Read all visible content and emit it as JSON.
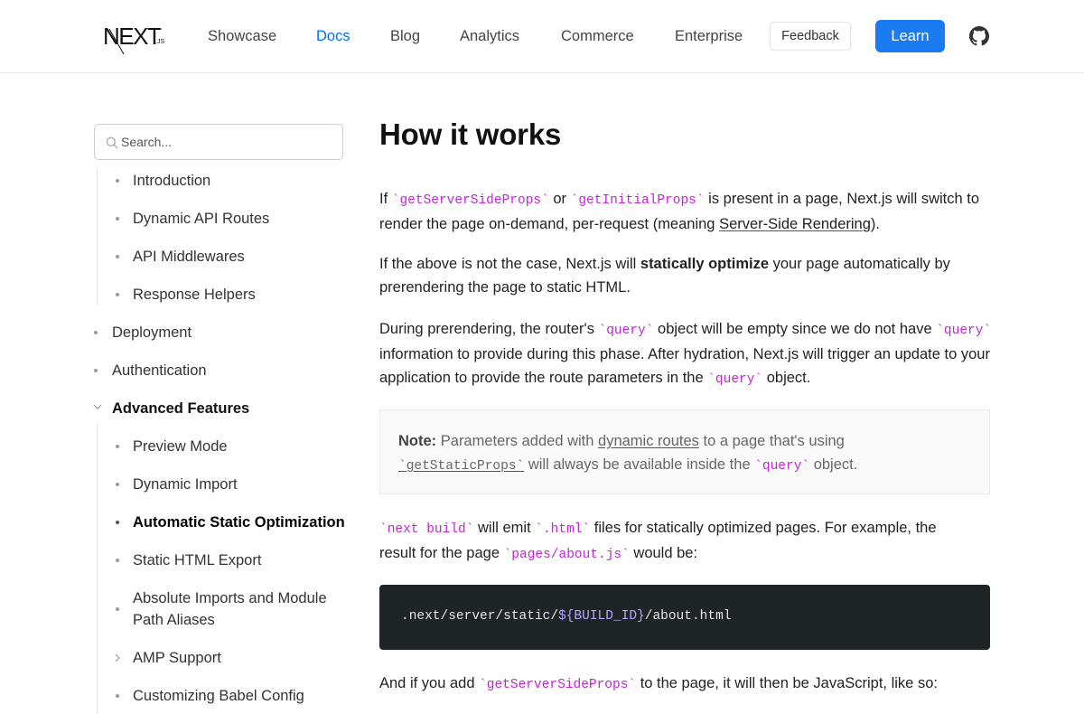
{
  "header": {
    "logo_text": "NEXT.js",
    "nav": [
      {
        "label": "Showcase",
        "active": false
      },
      {
        "label": "Docs",
        "active": true
      },
      {
        "label": "Blog",
        "active": false
      },
      {
        "label": "Analytics",
        "active": false
      },
      {
        "label": "Commerce",
        "active": false
      },
      {
        "label": "Enterprise",
        "active": false
      }
    ],
    "feedback_label": "Feedback",
    "learn_label": "Learn",
    "github_icon": "github-icon"
  },
  "sidebar": {
    "search_placeholder": "Search...",
    "items": [
      {
        "label": "Introduction",
        "level": 2
      },
      {
        "label": "Dynamic API Routes",
        "level": 2
      },
      {
        "label": "API Middlewares",
        "level": 2
      },
      {
        "label": "Response Helpers",
        "level": 2
      },
      {
        "label": "Deployment",
        "level": 1
      },
      {
        "label": "Authentication",
        "level": 1
      },
      {
        "label": "Advanced Features",
        "level": 1,
        "expanded": true
      },
      {
        "label": "Preview Mode",
        "level": 2
      },
      {
        "label": "Dynamic Import",
        "level": 2
      },
      {
        "label": "Automatic Static Optimization",
        "level": 2,
        "active": true
      },
      {
        "label": "Static HTML Export",
        "level": 2
      },
      {
        "label": "Absolute Imports and Module Path Aliases",
        "level": 2
      },
      {
        "label": "AMP Support",
        "level": 2,
        "collapsible": true
      },
      {
        "label": "Customizing Babel Config",
        "level": 2
      }
    ]
  },
  "content": {
    "title": "How it works",
    "p1": {
      "t1": "If ",
      "c1": "`getServerSideProps`",
      "t2": " or ",
      "c2": "`getInitialProps`",
      "t3": " is present in a page, Next.js will switch to render the page on-demand, per-request (meaning ",
      "link": "Server-Side Rendering",
      "t4": ")."
    },
    "p2": {
      "t1": "If the above is not the case, Next.js will ",
      "bold": "statically optimize",
      "t2": " your page automatically by prerendering the page to static HTML."
    },
    "p3": {
      "t1": "During prerendering, the router's ",
      "c1": "`query`",
      "t2": " object will be empty since we do not have ",
      "c2": "`query`",
      "t3": " information to provide during this phase. After hydration, Next.js will trigger an update to your application to provide the route parameters in the ",
      "c3": "`query`",
      "t4": " object."
    },
    "note": {
      "label": "Note:",
      "t1": " Parameters added with ",
      "link": "dynamic routes",
      "t2": " to a page that's using ",
      "c1": "`getStaticProps`",
      "t3": " will always be available inside the ",
      "c2": "`query`",
      "t4": " object."
    },
    "p4": {
      "c1": "`next build`",
      "t1": " will emit ",
      "c2": "`.html`",
      "t2": " files for statically optimized pages. For example, the result for the page ",
      "c3": "`pages/about.js`",
      "t3": " would be:"
    },
    "code": {
      "prefix": ".next/server/static/",
      "var": "${BUILD_ID}",
      "suffix": "/about.html"
    },
    "p5": {
      "t1": "And if you add ",
      "c1": "`getServerSideProps`",
      "t2": " to the page, it will then be JavaScript, like so:"
    }
  },
  "colors": {
    "accent": "#0070f3",
    "learn_button": "#1a7bf2",
    "code_inline": "#c026d3",
    "code_block_bg": "#1f2426"
  }
}
